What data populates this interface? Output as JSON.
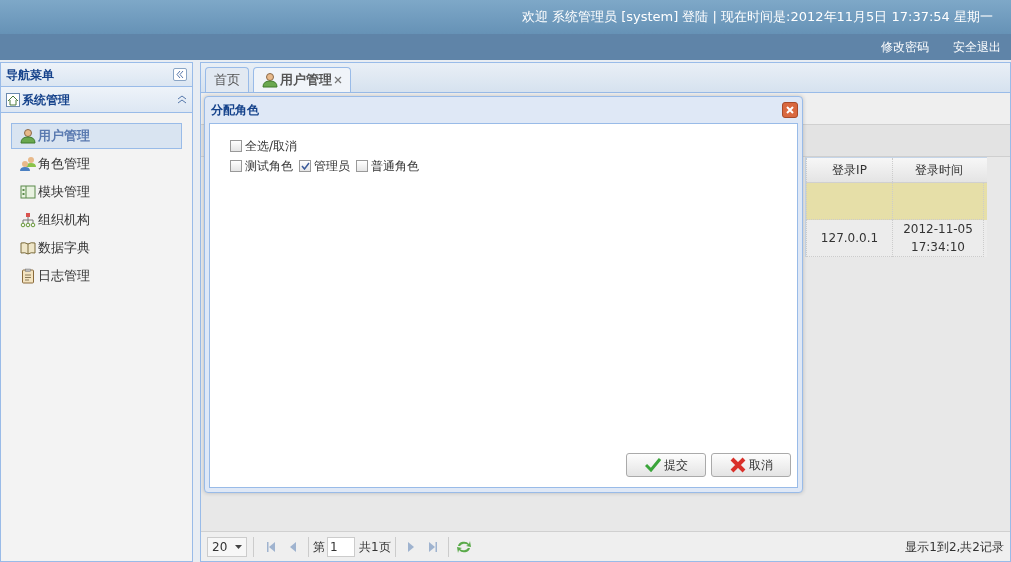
{
  "header": {
    "welcome": "欢迎 系统管理员 [system] 登陆 | 现在时间是:2012年11月5日 17:37:54 星期一",
    "links": [
      "修改密码",
      "安全退出"
    ]
  },
  "sidebar": {
    "title": "导航菜单",
    "section": {
      "label": "系统管理",
      "expanded": true
    },
    "items": [
      {
        "label": "用户管理",
        "kind": "user",
        "selected": true
      },
      {
        "label": "角色管理",
        "kind": "users",
        "selected": false
      },
      {
        "label": "模块管理",
        "kind": "module",
        "selected": false
      },
      {
        "label": "组织机构",
        "kind": "org",
        "selected": false
      },
      {
        "label": "数据字典",
        "kind": "book",
        "selected": false
      },
      {
        "label": "日志管理",
        "kind": "log",
        "selected": false
      }
    ]
  },
  "tabs": [
    {
      "label": "首页",
      "selected": false,
      "closable": false
    },
    {
      "label": "用户管理",
      "selected": true,
      "closable": true
    }
  ],
  "grid": {
    "columns": [
      "登录IP",
      "登录时间"
    ],
    "rows": [
      {
        "selected": true
      },
      {
        "selected": false,
        "login_ip": "127.0.0.1",
        "login_time": "2012-11-05 17:34:10"
      }
    ]
  },
  "dialog": {
    "title": "分配角色",
    "select_all": {
      "label": "全选/取消",
      "checked": false
    },
    "roles": [
      {
        "label": "测试角色",
        "checked": false
      },
      {
        "label": "管理员",
        "checked": true
      },
      {
        "label": "普通角色",
        "checked": false
      }
    ],
    "buttons": [
      {
        "label": "提交",
        "kind": "submit"
      },
      {
        "label": "取消",
        "kind": "cancel"
      }
    ]
  },
  "pager": {
    "page_size": "20",
    "page_prefix": "第",
    "page": "1",
    "page_suffix": "共1页",
    "summary": "显示1到2,共2记录"
  }
}
